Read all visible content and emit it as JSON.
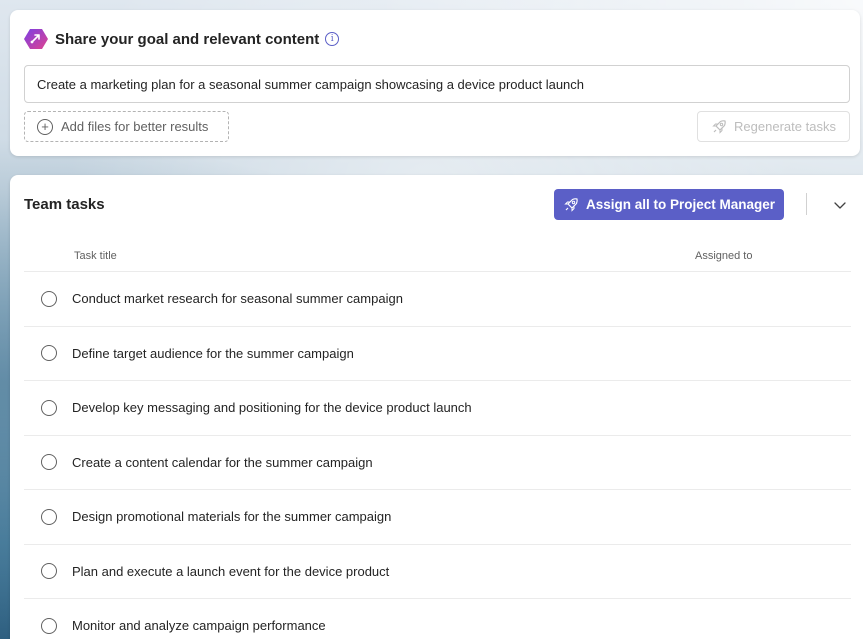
{
  "goal": {
    "title": "Share your goal and relevant content",
    "info_icon": "info-icon",
    "input_value": "Create a marketing plan for a seasonal summer campaign showcasing a device product launch",
    "add_files_label": "Add files for better results",
    "regenerate_label": "Regenerate tasks"
  },
  "tasks": {
    "title": "Team tasks",
    "assign_all_label": "Assign all to Project Manager",
    "columns": {
      "task_title": "Task title",
      "assigned_to": "Assigned to"
    },
    "items": [
      {
        "title": "Conduct market research for seasonal summer campaign"
      },
      {
        "title": "Define target audience for the summer campaign"
      },
      {
        "title": "Develop key messaging and positioning for the device product launch"
      },
      {
        "title": "Create a content calendar for the summer campaign"
      },
      {
        "title": "Design promotional materials for the summer campaign"
      },
      {
        "title": "Plan and execute a launch event for the device product"
      },
      {
        "title": "Monitor and analyze campaign performance"
      }
    ]
  },
  "colors": {
    "accent": "#5b5fc7",
    "logo_gradient_start": "#7b3fe4",
    "logo_gradient_end": "#e0438f"
  }
}
